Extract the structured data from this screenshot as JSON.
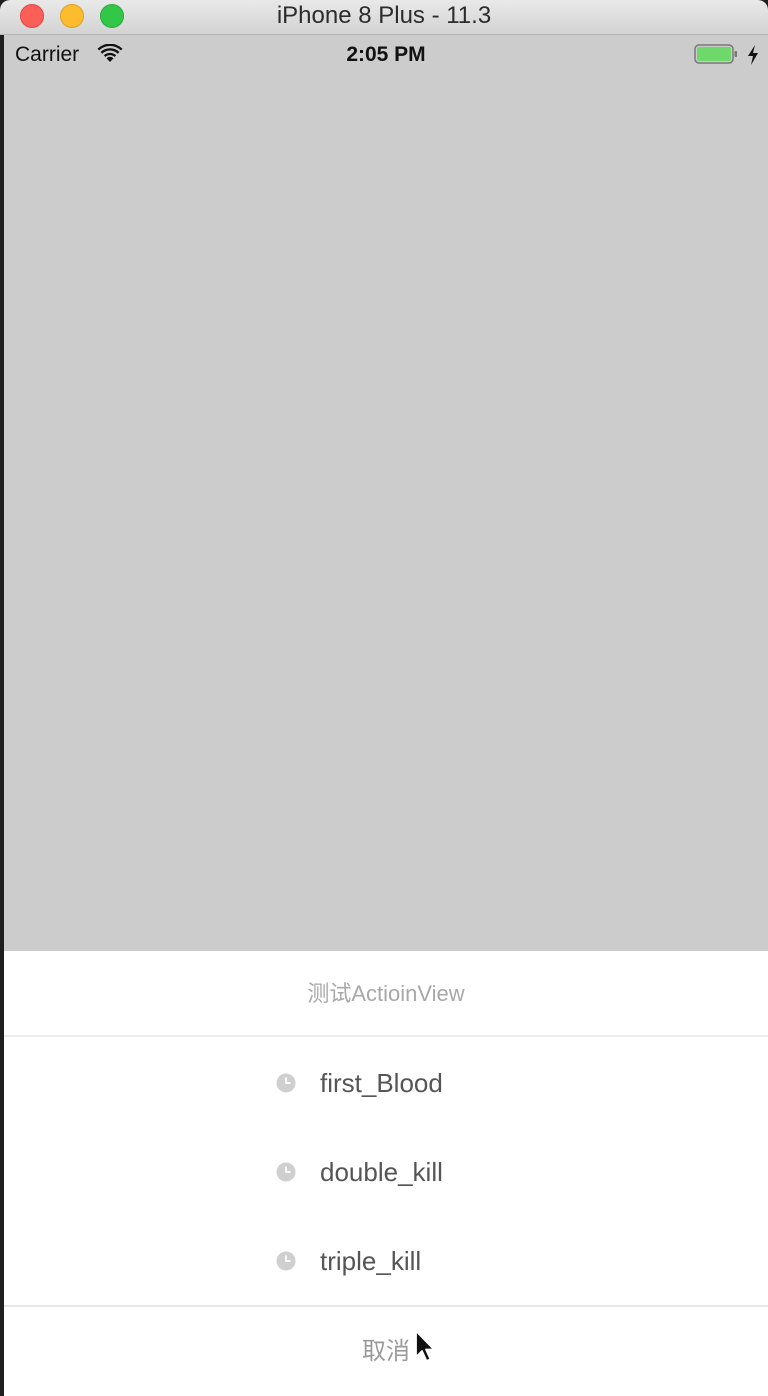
{
  "window": {
    "title": "iPhone 8 Plus - 11.3"
  },
  "status_bar": {
    "carrier": "Carrier",
    "time": "2:05 PM",
    "icons": [
      "wifi-icon",
      "battery-icon",
      "charging-icon"
    ]
  },
  "action_sheet": {
    "title": "测试ActioinView",
    "options": [
      {
        "label": "first_Blood",
        "icon": "clock-icon"
      },
      {
        "label": "double_kill",
        "icon": "clock-icon"
      },
      {
        "label": "triple_kill",
        "icon": "clock-icon"
      }
    ],
    "cancel_label": "取消"
  },
  "colors": {
    "background_dim": "#cccccc",
    "sheet_background": "#ffffff",
    "option_text": "#555555",
    "title_text": "#a8a8a8",
    "battery_fill": "#6fd86a"
  }
}
